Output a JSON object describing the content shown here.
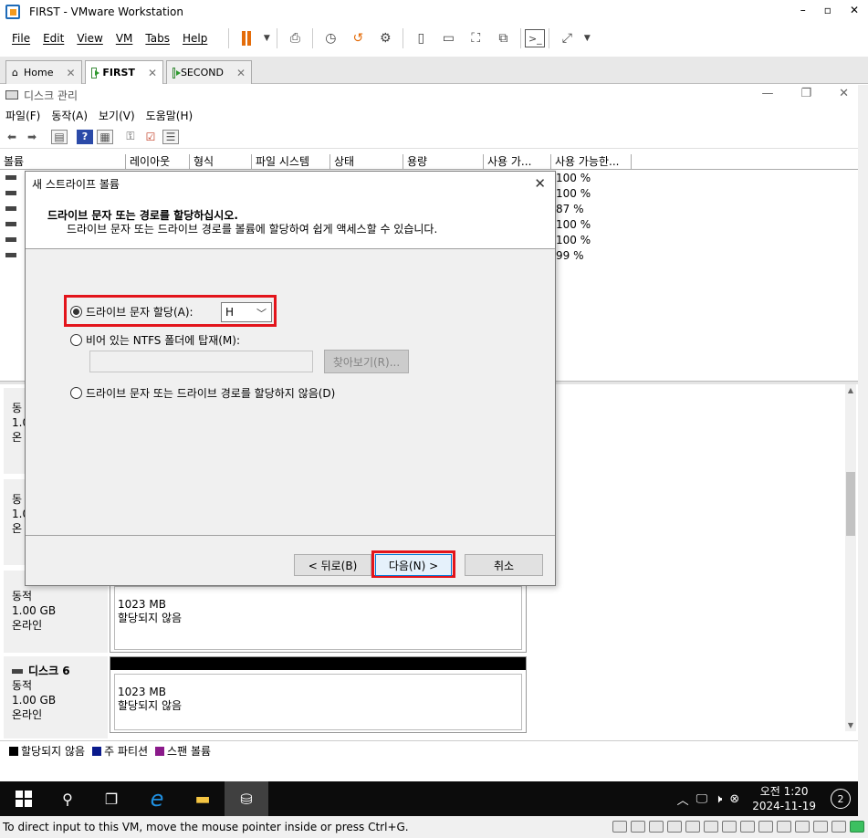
{
  "vmware": {
    "title": "FIRST - VMware Workstation",
    "menu": [
      "File",
      "Edit",
      "View",
      "VM",
      "Tabs",
      "Help"
    ],
    "tabs": [
      {
        "label": "Home",
        "active": false
      },
      {
        "label": "FIRST",
        "active": true
      },
      {
        "label": "SECOND",
        "active": false
      }
    ],
    "status_text": "To direct input to this VM, move the mouse pointer inside or press Ctrl+G."
  },
  "disk_mgmt": {
    "title": "디스크 관리",
    "menu": [
      "파일(F)",
      "동작(A)",
      "보기(V)",
      "도움말(H)"
    ],
    "columns": [
      "볼륨",
      "레이아웃",
      "형식",
      "파일 시스템",
      "상태",
      "용량",
      "사용 가...",
      "사용 가능한..."
    ],
    "volume_pct": [
      "100 %",
      "100 %",
      "87 %",
      "100 %",
      "100 %",
      "99 %"
    ],
    "disks": [
      {
        "type": "동적",
        "size": "1.00 GB",
        "status": "온라인",
        "part_size": "1023 MB",
        "part_status": "할당되지 않음"
      },
      {
        "name": "디스크 6",
        "type": "동적",
        "size": "1.00 GB",
        "status": "온라인",
        "part_size": "1023 MB",
        "part_status": "할당되지 않음"
      }
    ],
    "partial_labels": [
      {
        "line1": "동",
        "line2": "1.0",
        "line3": "온"
      },
      {
        "line1": "동",
        "line2": "1.0",
        "line3": "온"
      }
    ],
    "legend": [
      {
        "label": "할당되지 않음",
        "color": "#000000"
      },
      {
        "label": "주 파티션",
        "color": "#0a1a8c"
      },
      {
        "label": "스팬 볼륨",
        "color": "#8b1a8b"
      }
    ]
  },
  "wizard": {
    "title": "새 스트라이프 볼륨",
    "heading": "드라이브 문자 또는 경로를 할당하십시오.",
    "subheading": "드라이브 문자 또는 드라이브 경로를 볼륨에 할당하여 쉽게 액세스할 수 있습니다.",
    "option_assign": "드라이브 문자 할당(A):",
    "drive_letter": "H",
    "option_mount": "비어 있는 NTFS 폴더에 탑재(M):",
    "browse_label": "찾아보기(R)...",
    "option_none": "드라이브 문자 또는 드라이브 경로를 할당하지 않음(D)",
    "back_label": "< 뒤로(B)",
    "next_label": "다음(N) >",
    "cancel_label": "취소"
  },
  "taskbar": {
    "time": "오전 1:20",
    "date": "2024-11-19",
    "notification_count": "2"
  }
}
